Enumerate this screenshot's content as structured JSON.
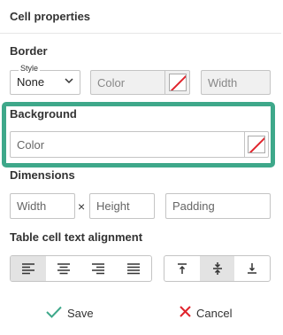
{
  "title": "Cell properties",
  "border": {
    "heading": "Border",
    "style_legend": "Style",
    "style_value": "None",
    "color_placeholder": "Color",
    "width_placeholder": "Width"
  },
  "background": {
    "heading": "Background",
    "color_placeholder": "Color"
  },
  "dimensions": {
    "heading": "Dimensions",
    "width_placeholder": "Width",
    "times": "×",
    "height_placeholder": "Height",
    "padding_placeholder": "Padding"
  },
  "alignment": {
    "heading": "Table cell text alignment",
    "horizontal": [
      "align-left-icon",
      "align-center-icon",
      "align-right-icon",
      "align-justify-icon"
    ],
    "horizontal_active": "align-left-icon",
    "vertical": [
      "align-top-icon",
      "align-middle-icon",
      "align-bottom-icon"
    ],
    "vertical_active": "align-middle-icon"
  },
  "footer": {
    "save_label": "Save",
    "cancel_label": "Cancel"
  },
  "colors": {
    "highlight": "#3ea88a",
    "save_check": "#3ea88a",
    "cancel_x": "#e0242c"
  }
}
